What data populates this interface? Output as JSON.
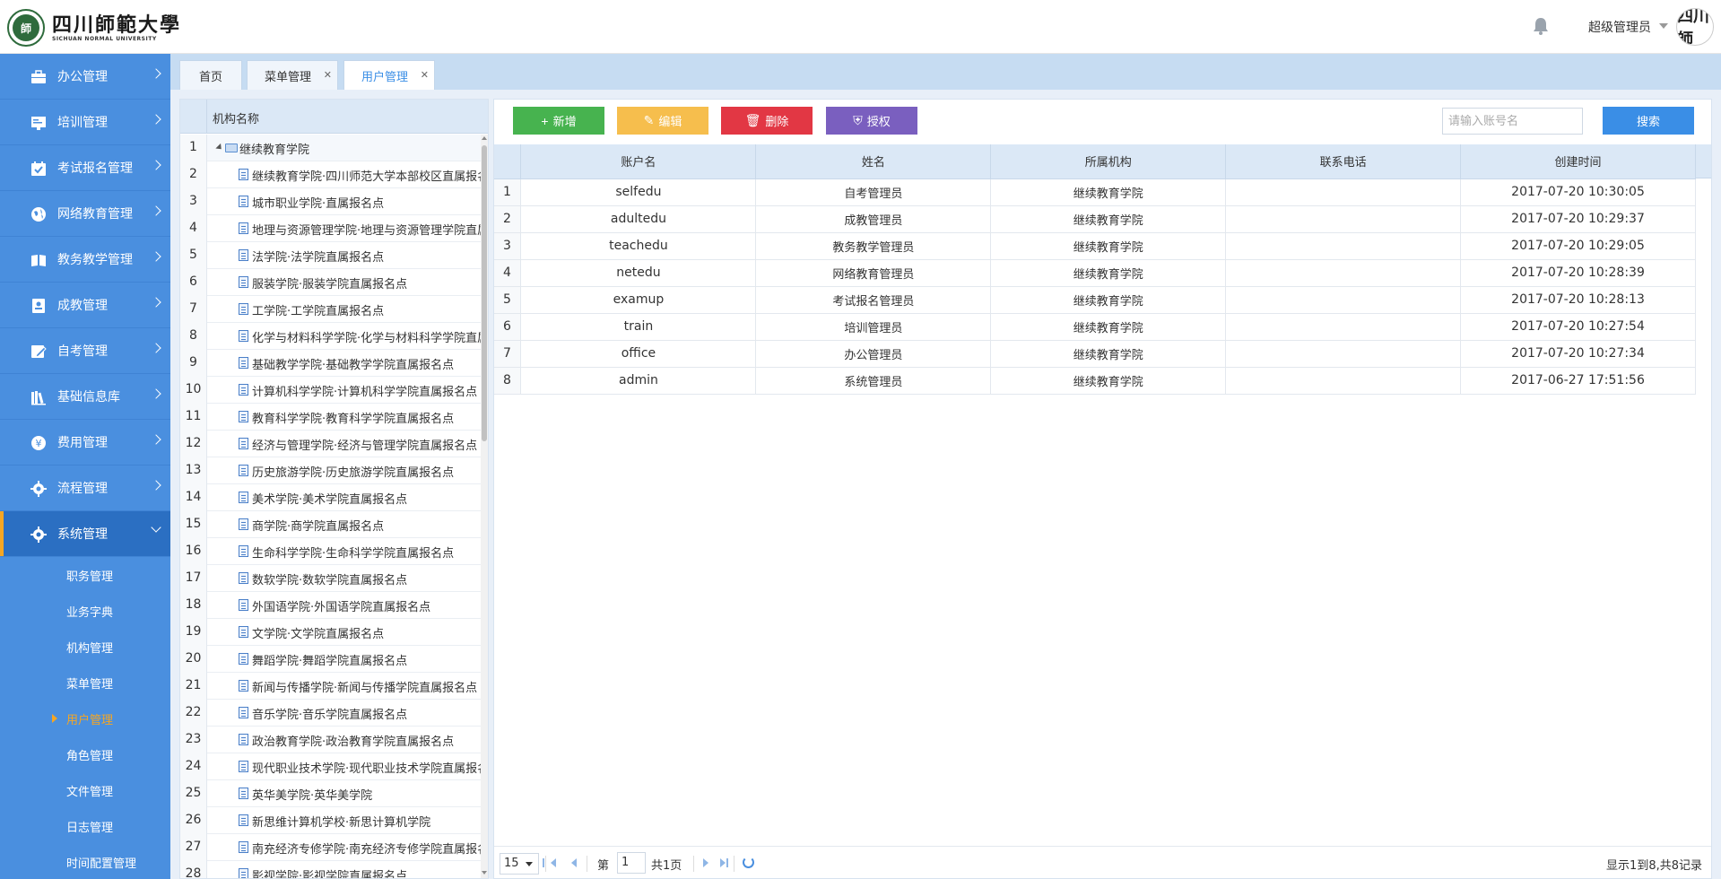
{
  "header": {
    "logo_cn": "四川師範大學",
    "logo_en": "SICHUAN NORMAL UNIVERSITY",
    "user_name": "超级管理员",
    "avatar_text": "四川師"
  },
  "sidebar": {
    "items": [
      {
        "label": "办公管理",
        "icon": "briefcase-icon"
      },
      {
        "label": "培训管理",
        "icon": "training-icon"
      },
      {
        "label": "考试报名管理",
        "icon": "calendar-check-icon"
      },
      {
        "label": "网络教育管理",
        "icon": "globe-icon"
      },
      {
        "label": "教务教学管理",
        "icon": "book-icon"
      },
      {
        "label": "成教管理",
        "icon": "id-card-icon"
      },
      {
        "label": "自考管理",
        "icon": "edit-icon"
      },
      {
        "label": "基础信息库",
        "icon": "library-icon"
      },
      {
        "label": "费用管理",
        "icon": "money-icon"
      },
      {
        "label": "流程管理",
        "icon": "gear-icon"
      },
      {
        "label": "系统管理",
        "icon": "gear-icon"
      }
    ],
    "sub_items": [
      "职务管理",
      "业务字典",
      "机构管理",
      "菜单管理",
      "用户管理",
      "角色管理",
      "文件管理",
      "日志管理",
      "时间配置管理"
    ]
  },
  "tabs": [
    {
      "label": "首页"
    },
    {
      "label": "菜单管理"
    },
    {
      "label": "用户管理"
    }
  ],
  "tree": {
    "header": "机构名称",
    "root": "继续教育学院",
    "rows": [
      "继续教育学院·四川师范大学本部校区直属报名点",
      "城市职业学院·直属报名点",
      "地理与资源管理学院·地理与资源管理学院直属报名点",
      "法学院·法学院直属报名点",
      "服装学院·服装学院直属报名点",
      "工学院·工学院直属报名点",
      "化学与材料科学学院·化学与材料科学学院直属报名点",
      "基础教学学院·基础教学学院直属报名点",
      "计算机科学学院·计算机科学学院直属报名点",
      "教育科学学院·教育科学学院直属报名点",
      "经济与管理学院·经济与管理学院直属报名点",
      "历史旅游学院·历史旅游学院直属报名点",
      "美术学院·美术学院直属报名点",
      "商学院·商学院直属报名点",
      "生命科学学院·生命科学学院直属报名点",
      "数软学院·数软学院直属报名点",
      "外国语学院·外国语学院直属报名点",
      "文学院·文学院直属报名点",
      "舞蹈学院·舞蹈学院直属报名点",
      "新闻与传播学院·新闻与传播学院直属报名点",
      "音乐学院·音乐学院直属报名点",
      "政治教育学院·政治教育学院直属报名点",
      "现代职业技术学院·现代职业技术学院直属报名点",
      "英华美学院·英华美学院",
      "新思维计算机学校·新思计算机学院",
      "南充经济专修学院·南充经济专修学院直属报名点",
      "影视学院·影视学院直属报名点"
    ]
  },
  "toolbar": {
    "add": "新增",
    "edit": "编辑",
    "delete": "删除",
    "authorize": "授权",
    "search_placeholder": "请输入账号名",
    "search": "搜索"
  },
  "table": {
    "columns": [
      "账户名",
      "姓名",
      "所属机构",
      "联系电话",
      "创建时间"
    ],
    "rows": [
      [
        "selfedu",
        "自考管理员",
        "继续教育学院",
        "",
        "2017-07-20 10:30:05"
      ],
      [
        "adultedu",
        "成教管理员",
        "继续教育学院",
        "",
        "2017-07-20 10:29:37"
      ],
      [
        "teachedu",
        "教务教学管理员",
        "继续教育学院",
        "",
        "2017-07-20 10:29:05"
      ],
      [
        "netedu",
        "网络教育管理员",
        "继续教育学院",
        "",
        "2017-07-20 10:28:39"
      ],
      [
        "examup",
        "考试报名管理员",
        "继续教育学院",
        "",
        "2017-07-20 10:28:13"
      ],
      [
        "train",
        "培训管理员",
        "继续教育学院",
        "",
        "2017-07-20 10:27:54"
      ],
      [
        "office",
        "办公管理员",
        "继续教育学院",
        "",
        "2017-07-20 10:27:34"
      ],
      [
        "admin",
        "系统管理员",
        "继续教育学院",
        "",
        "2017-06-27 17:51:56"
      ]
    ]
  },
  "pager": {
    "page_size": "15",
    "page_prefix": "第",
    "page_num": "1",
    "page_suffix": "共1页",
    "info": "显示1到8,共8记录"
  }
}
